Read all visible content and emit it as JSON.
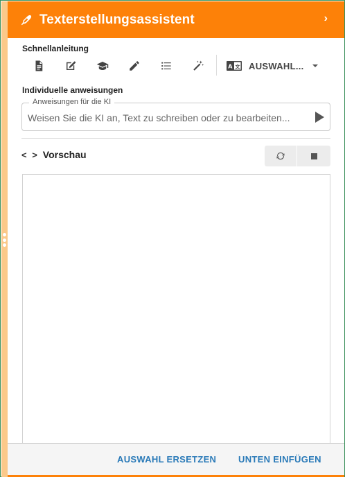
{
  "header": {
    "title": "Texterstellungsassistent",
    "chevron": "›",
    "icon": "pen-icon"
  },
  "quick_guide": {
    "label": "Schnellanleitung",
    "tools": [
      {
        "name": "document-icon"
      },
      {
        "name": "edit-icon"
      },
      {
        "name": "graduation-cap-icon"
      },
      {
        "name": "pencil-icon"
      },
      {
        "name": "list-icon"
      },
      {
        "name": "magic-wand-icon"
      }
    ],
    "selector": {
      "label": "AUSWAHL...",
      "icon": "language-icon"
    }
  },
  "instructions": {
    "label": "Individuelle anweisungen",
    "legend": "Anweisungen für die KI",
    "placeholder": "Weisen Sie die KI an, Text zu schreiben oder zu bearbeiten..."
  },
  "preview": {
    "code_symbol": "< >",
    "title": "Vorschau"
  },
  "footer": {
    "replace_label": "AUSWAHL ERSETZEN",
    "insert_label": "UNTEN EINFÜGEN"
  },
  "colors": {
    "accent": "#fd8108",
    "accent_light": "#fbc98a",
    "link": "#2a7ab8"
  }
}
